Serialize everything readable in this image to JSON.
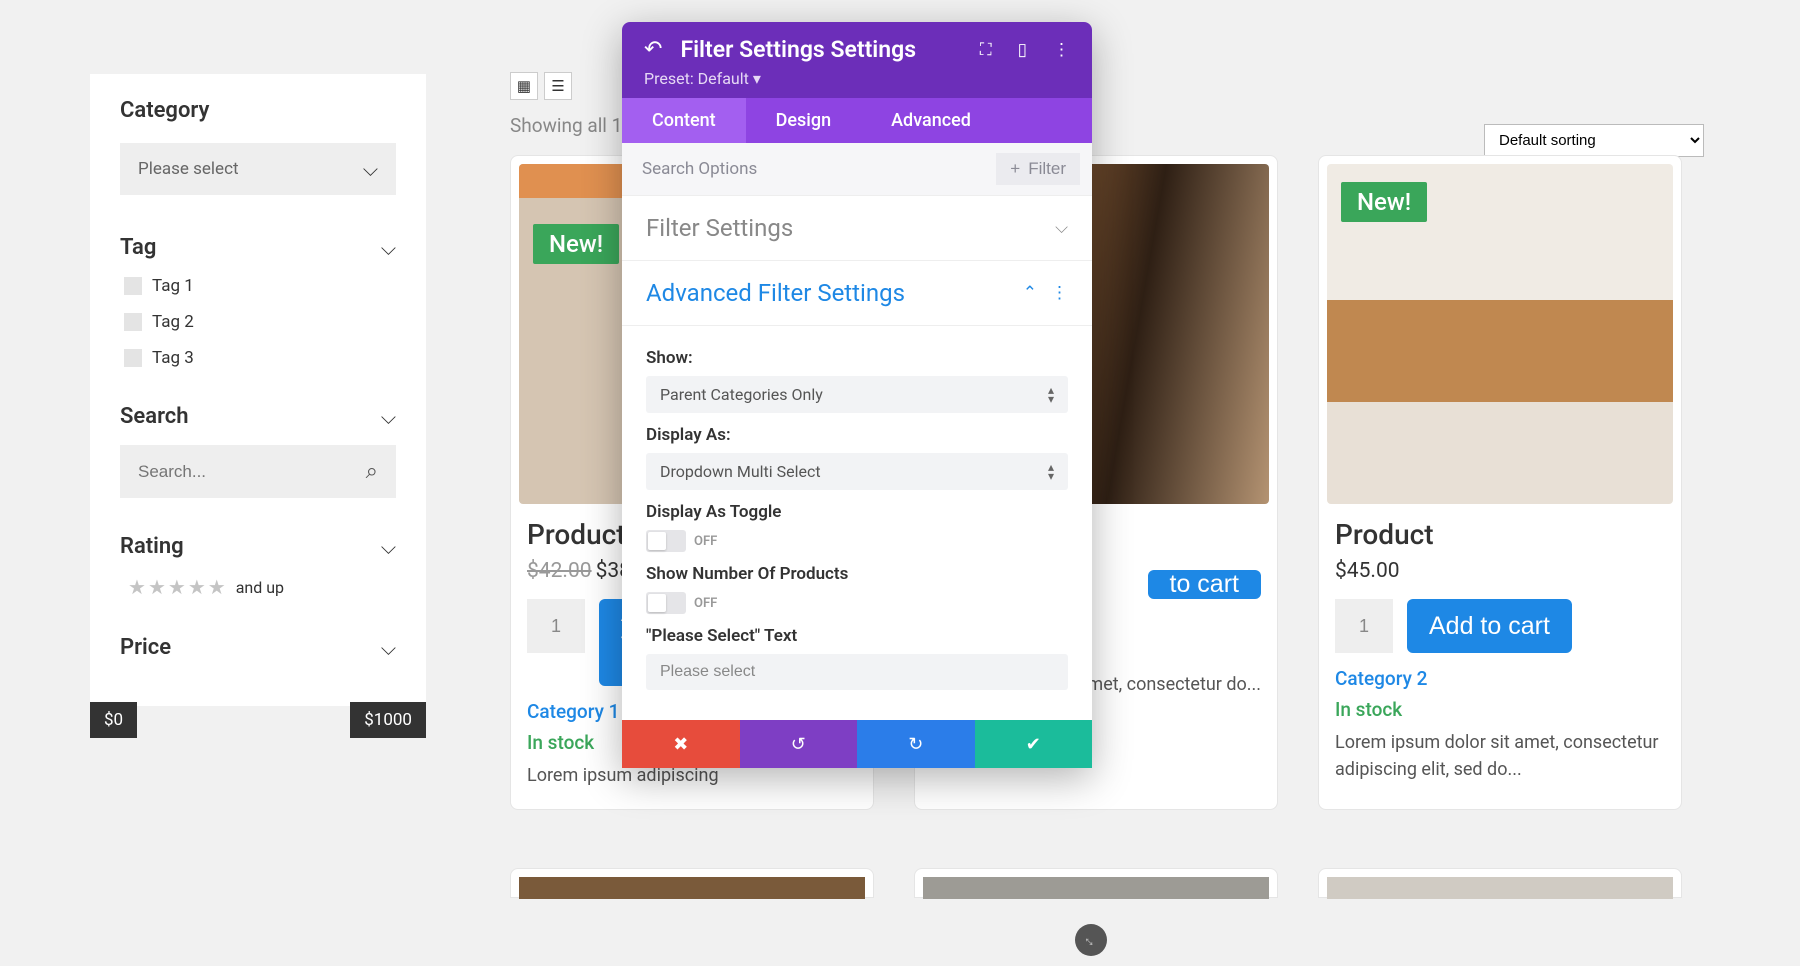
{
  "sidebar": {
    "category_title": "Category",
    "category_select_placeholder": "Please select",
    "tag_title": "Tag",
    "tags": [
      "Tag 1",
      "Tag 2",
      "Tag 3"
    ],
    "search_title": "Search",
    "search_placeholder": "Search...",
    "rating_title": "Rating",
    "rating_suffix": "and up",
    "price_title": "Price",
    "price_min": "$0",
    "price_max": "$1000"
  },
  "main": {
    "showing": "Showing all 1",
    "sort_default": "Default sorting"
  },
  "products": [
    {
      "title": "Product",
      "old_price": "$42.00",
      "price": "$38",
      "qty": "1",
      "category": "Category 1",
      "stock": "In stock",
      "desc": "Lorem ipsum adipiscing ",
      "badge": "New!",
      "add": "Add to cart",
      "sale": true
    },
    {
      "title": "",
      "price": "",
      "qty": "",
      "category": "",
      "stock": "",
      "desc": "sit amet, consectetur do...",
      "badge": "",
      "add": "to cart"
    },
    {
      "title": "Product",
      "price": "$45.00",
      "qty": "1",
      "category": "Category 2",
      "stock": "In stock",
      "desc": "Lorem ipsum dolor sit amet, consectetur adipiscing elit, sed do...",
      "badge": "New!",
      "add": "Add to cart"
    }
  ],
  "modal": {
    "title": "Filter Settings Settings",
    "preset": "Preset: Default",
    "tabs": {
      "content": "Content",
      "design": "Design",
      "advanced": "Advanced"
    },
    "search_options": "Search Options",
    "add_filter": "Filter",
    "sections": {
      "filter_settings": "Filter Settings",
      "advanced_filter_settings": "Advanced Filter Settings"
    },
    "fields": {
      "show_label": "Show:",
      "show_value": "Parent Categories Only",
      "display_as_label": "Display As:",
      "display_as_value": "Dropdown Multi Select",
      "display_toggle_label": "Display As Toggle",
      "display_toggle_state": "OFF",
      "show_number_label": "Show Number Of Products",
      "show_number_state": "OFF",
      "please_select_label": "\"Please Select\" Text",
      "please_select_value": "Please select"
    }
  }
}
